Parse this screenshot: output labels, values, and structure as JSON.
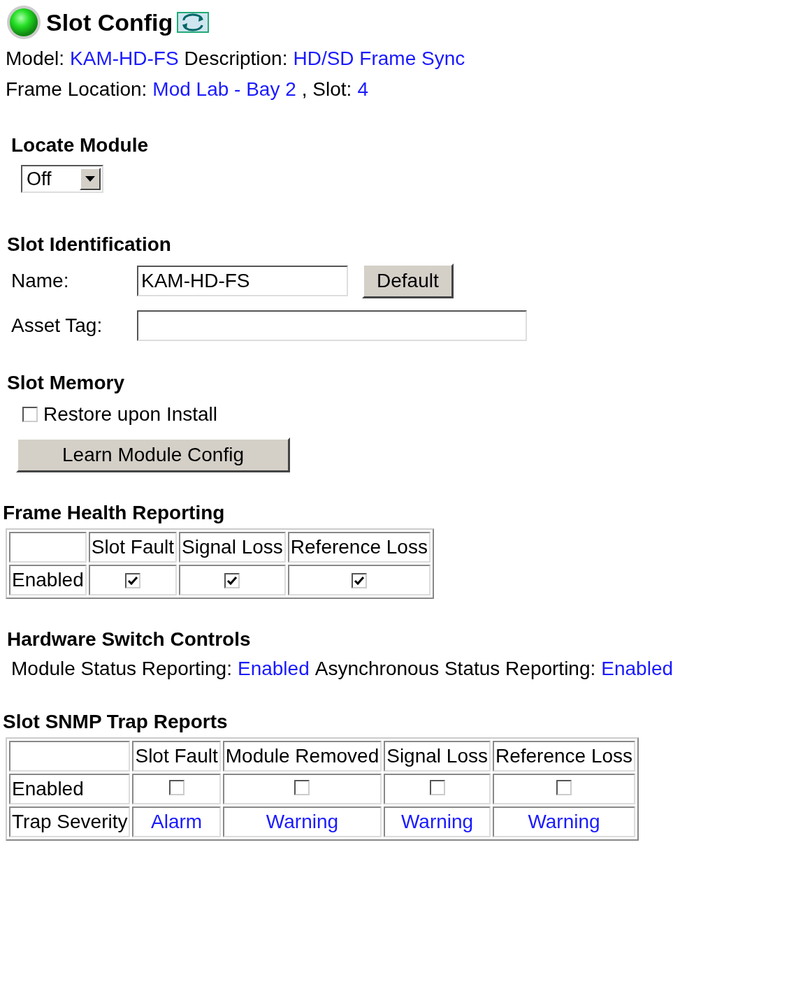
{
  "header": {
    "title": "Slot Config"
  },
  "module_info": [
    [
      {
        "label": "Model:",
        "value": "KAM-HD-FS"
      },
      {
        "label": "Description:",
        "value": "HD/SD Frame Sync"
      }
    ],
    [
      {
        "label": "Frame Location:",
        "value": "Mod Lab - Bay 2"
      },
      {
        "label": ", Slot:",
        "value": "4"
      }
    ]
  ],
  "locate_module": {
    "heading": "Locate Module",
    "value": "Off"
  },
  "slot_identification": {
    "heading": "Slot Identification",
    "fields": [
      {
        "label": "Name:",
        "value": "KAM-HD-FS",
        "button": "Default"
      },
      {
        "label": "Asset Tag:"
      }
    ]
  },
  "slot_memory": {
    "heading": "Slot Memory",
    "checkbox": {
      "label": "Restore upon Install",
      "checked": false
    },
    "button": "Learn Module Config"
  },
  "frame_health": {
    "heading": "Frame Health Reporting",
    "columns": [
      "Slot Fault",
      "Signal Loss",
      "Reference Loss"
    ],
    "rows": [
      {
        "label": "Enabled",
        "kind": "checkbox",
        "cells": [
          {
            "checked": true
          },
          {
            "checked": true
          },
          {
            "checked": true
          }
        ]
      }
    ]
  },
  "hardware_switch": {
    "heading": "Hardware Switch Controls",
    "items": [
      {
        "label": "Module Status Reporting:",
        "value": "Enabled"
      },
      {
        "label": "Asynchronous Status Reporting:",
        "value": "Enabled"
      }
    ]
  },
  "snmp": {
    "heading": "Slot SNMP Trap Reports",
    "columns": [
      "Slot Fault",
      "Module Removed",
      "Signal Loss",
      "Reference Loss"
    ],
    "rows": [
      {
        "label": "Enabled",
        "kind": "checkbox",
        "cells": [
          {
            "checked": false
          },
          {
            "checked": false
          },
          {
            "checked": false
          },
          {
            "checked": false
          }
        ]
      },
      {
        "label": "Trap Severity",
        "kind": "link",
        "cells": [
          {
            "text": "Alarm"
          },
          {
            "text": "Warning"
          },
          {
            "text": "Warning"
          },
          {
            "text": "Warning"
          }
        ]
      }
    ]
  }
}
